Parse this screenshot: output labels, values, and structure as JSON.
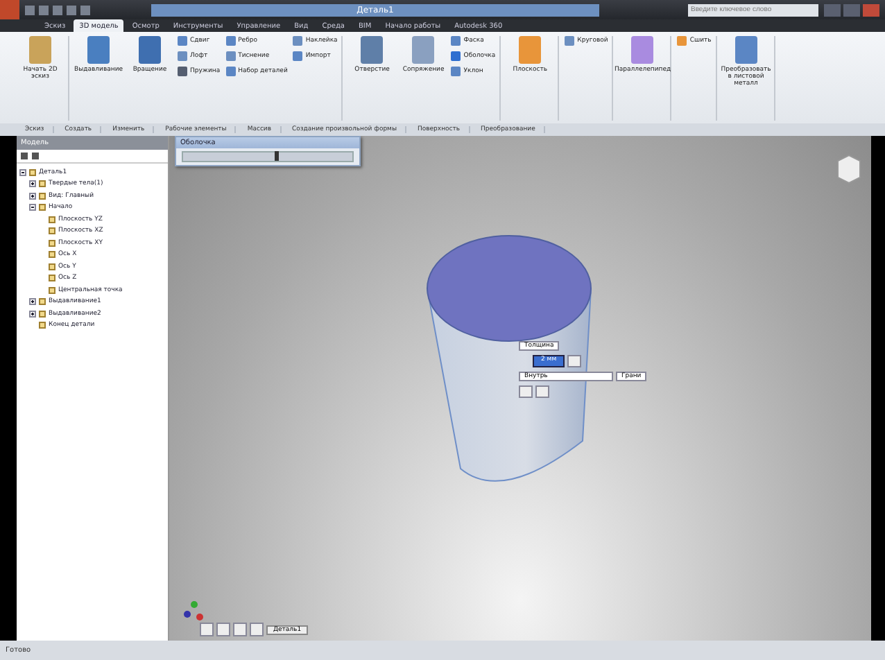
{
  "window": {
    "title": "Деталь1",
    "search": {
      "placeholder": "Введите ключевое слово"
    }
  },
  "tabs": [
    {
      "label": "Эскиз",
      "selected": false
    },
    {
      "label": "3D модель",
      "selected": true
    },
    {
      "label": "Осмотр",
      "selected": false
    },
    {
      "label": "Инструменты",
      "selected": false
    },
    {
      "label": "Управление",
      "selected": false
    },
    {
      "label": "Вид",
      "selected": false
    },
    {
      "label": "Среда",
      "selected": false
    },
    {
      "label": "BIM",
      "selected": false
    },
    {
      "label": "Начало работы",
      "selected": false
    },
    {
      "label": "Autodesk 360",
      "selected": false
    }
  ],
  "ribbon": [
    {
      "label": "Эскиз",
      "tools": [
        {
          "kind": "large",
          "label": "Начать 2D эскиз",
          "color": "#c9a35a"
        }
      ]
    },
    {
      "label": "Создать",
      "tools": [
        {
          "kind": "large",
          "label": "Выдавливание",
          "color": "#4a7fc0"
        },
        {
          "kind": "large",
          "label": "Вращение",
          "color": "#3f6fb0"
        },
        {
          "kind": "small",
          "label": "Сдвиг",
          "color": "#5b86c4"
        },
        {
          "kind": "small",
          "label": "Лофт",
          "color": "#6c8fc0"
        },
        {
          "kind": "small",
          "label": "Пружина",
          "color": "#555e70"
        },
        {
          "kind": "small",
          "label": "Ребро",
          "color": "#5b86c4"
        },
        {
          "kind": "small",
          "label": "Тиснение",
          "color": "#6c8fc0"
        },
        {
          "kind": "small",
          "label": "Набор деталей",
          "color": "#5b86c4"
        },
        {
          "kind": "small",
          "label": "Наклейка",
          "color": "#6c8fc0"
        },
        {
          "kind": "small",
          "label": "Импорт",
          "color": "#5b86c4"
        }
      ]
    },
    {
      "label": "Изменить",
      "tools": [
        {
          "kind": "large",
          "label": "Отверстие",
          "color": "#5f7fa8"
        },
        {
          "kind": "large",
          "label": "Сопряжение",
          "color": "#8aa0c0"
        },
        {
          "kind": "small",
          "label": "Фаска",
          "color": "#5b86c4"
        },
        {
          "kind": "small",
          "label": "Оболочка",
          "color": "#2f6fd0"
        },
        {
          "kind": "small",
          "label": "Уклон",
          "color": "#5b86c4"
        }
      ]
    },
    {
      "label": "Рабочие элементы",
      "tools": [
        {
          "kind": "large",
          "label": "Плоскость",
          "color": "#e8953a"
        }
      ]
    },
    {
      "label": "Массив",
      "tools": [
        {
          "kind": "small",
          "label": "Круговой",
          "color": "#6c8fc0"
        }
      ]
    },
    {
      "label": "Создание произвольной формы",
      "tools": [
        {
          "kind": "large",
          "label": "Параллелепипед",
          "color": "#a98be0"
        }
      ]
    },
    {
      "label": "Поверхность",
      "tools": [
        {
          "kind": "small",
          "label": "Сшить",
          "color": "#e8953a"
        }
      ]
    },
    {
      "label": "Преобразование",
      "tools": [
        {
          "kind": "large",
          "label": "Преобразовать в листовой металл",
          "color": "#5b86c4"
        }
      ]
    }
  ],
  "browser": {
    "title": "Модель",
    "tree": [
      {
        "label": "Деталь1",
        "expanded": true,
        "children": [
          {
            "label": "Твердые тела(1)",
            "expanded": false
          },
          {
            "label": "Вид: Главный",
            "expanded": false
          },
          {
            "label": "Начало",
            "expanded": true,
            "children": [
              {
                "label": "Плоскость YZ"
              },
              {
                "label": "Плоскость XZ"
              },
              {
                "label": "Плоскость XY"
              },
              {
                "label": "Ось X"
              },
              {
                "label": "Ось Y"
              },
              {
                "label": "Ось Z"
              },
              {
                "label": "Центральная точка"
              }
            ]
          },
          {
            "label": "Выдавливание1",
            "expanded": false
          },
          {
            "label": "Выдавливание2",
            "expanded": false
          },
          {
            "label": "Конец детали"
          }
        ]
      }
    ]
  },
  "panel": {
    "title": "Оболочка",
    "level": 0.55
  },
  "mini_toolbar": {
    "mode": "Толщина",
    "value": "2 мм",
    "direction": "Внутрь",
    "face": "Грани"
  },
  "document_tab": "Деталь1",
  "status_bar": "Готово"
}
